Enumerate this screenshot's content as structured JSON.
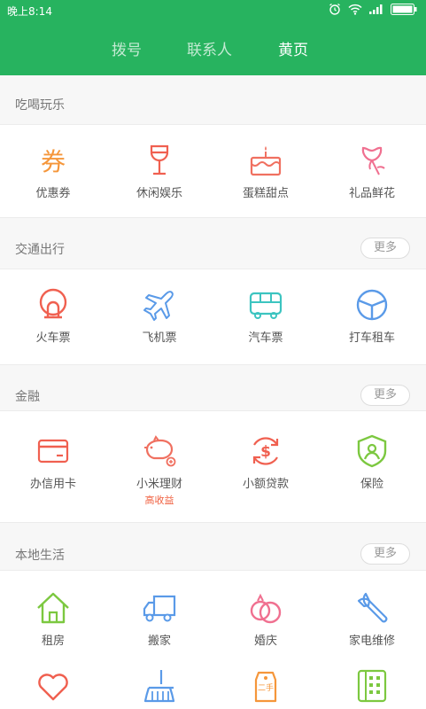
{
  "status_bar": {
    "time": "晚上8:14"
  },
  "tabs": [
    {
      "label": "拨号"
    },
    {
      "label": "联系人"
    },
    {
      "label": "黄页"
    }
  ],
  "sections": [
    {
      "title": "吃喝玩乐",
      "items": [
        {
          "label": "优惠券",
          "icon": "coupon-icon"
        },
        {
          "label": "休闲娱乐",
          "icon": "wine-glass-icon"
        },
        {
          "label": "蛋糕甜点",
          "icon": "cake-icon"
        },
        {
          "label": "礼品鲜花",
          "icon": "flower-icon"
        }
      ]
    },
    {
      "title": "交通出行",
      "more_label": "更多",
      "items": [
        {
          "label": "火车票",
          "icon": "train-icon"
        },
        {
          "label": "飞机票",
          "icon": "airplane-icon"
        },
        {
          "label": "汽车票",
          "icon": "bus-icon"
        },
        {
          "label": "打车租车",
          "icon": "steering-wheel-icon"
        }
      ]
    },
    {
      "title": "金融",
      "more_label": "更多",
      "items": [
        {
          "label": "办信用卡",
          "icon": "credit-card-icon"
        },
        {
          "label": "小米理财",
          "sub": "高收益",
          "icon": "piggy-bank-icon"
        },
        {
          "label": "小额贷款",
          "icon": "dollar-cycle-icon"
        },
        {
          "label": "保险",
          "icon": "shield-icon"
        }
      ]
    },
    {
      "title": "本地生活",
      "more_label": "更多",
      "items": [
        {
          "label": "租房",
          "icon": "house-icon"
        },
        {
          "label": "搬家",
          "icon": "truck-icon"
        },
        {
          "label": "婚庆",
          "icon": "rings-icon"
        },
        {
          "label": "家电维修",
          "icon": "wrench-icon"
        },
        {
          "label": "",
          "icon": "heart-icon"
        },
        {
          "label": "",
          "icon": "broom-icon"
        },
        {
          "label": "二手",
          "icon": "secondhand-tag-icon"
        },
        {
          "label": "",
          "icon": "phone-grid-icon"
        }
      ]
    }
  ],
  "colors": {
    "header": "#27b35f",
    "orange": "#f5963a",
    "red": "#f06050",
    "pink": "#f07090",
    "blue": "#5a9ae8",
    "teal": "#3cc4c0",
    "green": "#7cc840"
  }
}
